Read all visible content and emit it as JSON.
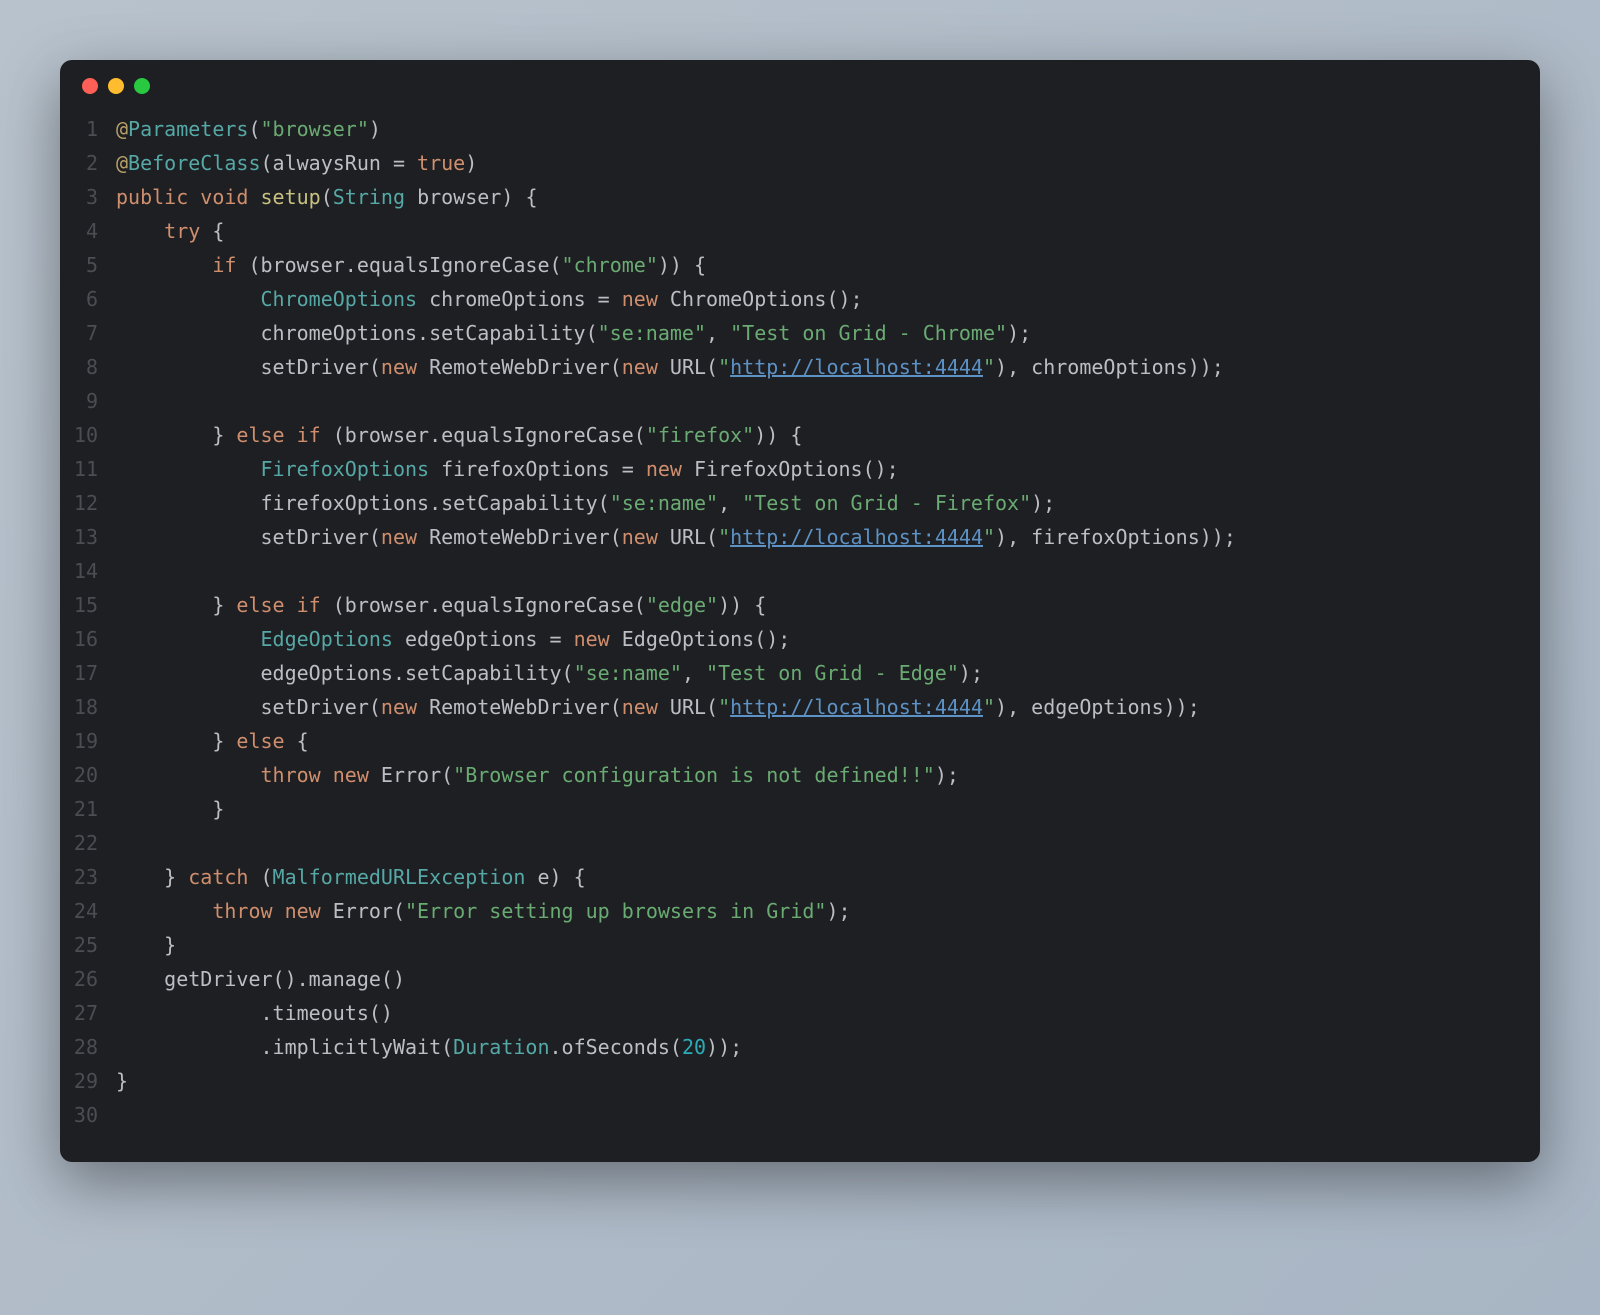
{
  "window": {
    "dots": {
      "close": "#ff5f57",
      "minimize": "#febc2e",
      "maximize": "#28c840"
    }
  },
  "code": {
    "lines": [
      {
        "num": "1",
        "tokens": [
          {
            "t": "@",
            "c": "tok-annotation"
          },
          {
            "t": "Parameters",
            "c": "tok-annotation-name"
          },
          {
            "t": "(",
            "c": "tok-plain"
          },
          {
            "t": "\"browser\"",
            "c": "tok-string"
          },
          {
            "t": ")",
            "c": "tok-plain"
          }
        ]
      },
      {
        "num": "2",
        "tokens": [
          {
            "t": "@",
            "c": "tok-annotation"
          },
          {
            "t": "BeforeClass",
            "c": "tok-annotation-name"
          },
          {
            "t": "(alwaysRun = ",
            "c": "tok-plain"
          },
          {
            "t": "true",
            "c": "tok-literal"
          },
          {
            "t": ")",
            "c": "tok-plain"
          }
        ]
      },
      {
        "num": "3",
        "tokens": [
          {
            "t": "public void ",
            "c": "tok-keyword"
          },
          {
            "t": "setup",
            "c": "tok-method"
          },
          {
            "t": "(",
            "c": "tok-plain"
          },
          {
            "t": "String ",
            "c": "tok-type"
          },
          {
            "t": "browser",
            "c": "tok-ident"
          },
          {
            "t": ") {",
            "c": "tok-plain"
          }
        ]
      },
      {
        "num": "4",
        "tokens": [
          {
            "t": "    ",
            "c": "tok-plain"
          },
          {
            "t": "try ",
            "c": "tok-keyword"
          },
          {
            "t": "{",
            "c": "tok-plain"
          }
        ]
      },
      {
        "num": "5",
        "tokens": [
          {
            "t": "        ",
            "c": "tok-plain"
          },
          {
            "t": "if ",
            "c": "tok-keyword"
          },
          {
            "t": "(browser.equalsIgnoreCase(",
            "c": "tok-plain"
          },
          {
            "t": "\"chrome\"",
            "c": "tok-string"
          },
          {
            "t": ")) {",
            "c": "tok-plain"
          }
        ]
      },
      {
        "num": "6",
        "tokens": [
          {
            "t": "            ",
            "c": "tok-plain"
          },
          {
            "t": "ChromeOptions ",
            "c": "tok-type"
          },
          {
            "t": "chromeOptions = ",
            "c": "tok-ident"
          },
          {
            "t": "new ",
            "c": "tok-keyword"
          },
          {
            "t": "ChromeOptions();",
            "c": "tok-plain"
          }
        ]
      },
      {
        "num": "7",
        "tokens": [
          {
            "t": "            chromeOptions.setCapability(",
            "c": "tok-plain"
          },
          {
            "t": "\"se:name\"",
            "c": "tok-string"
          },
          {
            "t": ", ",
            "c": "tok-plain"
          },
          {
            "t": "\"Test on Grid - Chrome\"",
            "c": "tok-string"
          },
          {
            "t": ");",
            "c": "tok-plain"
          }
        ]
      },
      {
        "num": "8",
        "tokens": [
          {
            "t": "            setDriver(",
            "c": "tok-plain"
          },
          {
            "t": "new ",
            "c": "tok-keyword"
          },
          {
            "t": "RemoteWebDriver(",
            "c": "tok-plain"
          },
          {
            "t": "new ",
            "c": "tok-keyword"
          },
          {
            "t": "URL(",
            "c": "tok-plain"
          },
          {
            "t": "\"",
            "c": "tok-string"
          },
          {
            "t": "http://localhost:4444",
            "c": "tok-string-url"
          },
          {
            "t": "\"",
            "c": "tok-string"
          },
          {
            "t": "), chromeOptions));",
            "c": "tok-plain"
          }
        ]
      },
      {
        "num": "9",
        "tokens": []
      },
      {
        "num": "10",
        "tokens": [
          {
            "t": "        } ",
            "c": "tok-plain"
          },
          {
            "t": "else if ",
            "c": "tok-keyword"
          },
          {
            "t": "(browser.equalsIgnoreCase(",
            "c": "tok-plain"
          },
          {
            "t": "\"firefox\"",
            "c": "tok-string"
          },
          {
            "t": ")) {",
            "c": "tok-plain"
          }
        ]
      },
      {
        "num": "11",
        "tokens": [
          {
            "t": "            ",
            "c": "tok-plain"
          },
          {
            "t": "FirefoxOptions ",
            "c": "tok-type"
          },
          {
            "t": "firefoxOptions = ",
            "c": "tok-ident"
          },
          {
            "t": "new ",
            "c": "tok-keyword"
          },
          {
            "t": "FirefoxOptions();",
            "c": "tok-plain"
          }
        ]
      },
      {
        "num": "12",
        "tokens": [
          {
            "t": "            firefoxOptions.setCapability(",
            "c": "tok-plain"
          },
          {
            "t": "\"se:name\"",
            "c": "tok-string"
          },
          {
            "t": ", ",
            "c": "tok-plain"
          },
          {
            "t": "\"Test on Grid - Firefox\"",
            "c": "tok-string"
          },
          {
            "t": ");",
            "c": "tok-plain"
          }
        ]
      },
      {
        "num": "13",
        "tokens": [
          {
            "t": "            setDriver(",
            "c": "tok-plain"
          },
          {
            "t": "new ",
            "c": "tok-keyword"
          },
          {
            "t": "RemoteWebDriver(",
            "c": "tok-plain"
          },
          {
            "t": "new ",
            "c": "tok-keyword"
          },
          {
            "t": "URL(",
            "c": "tok-plain"
          },
          {
            "t": "\"",
            "c": "tok-string"
          },
          {
            "t": "http://localhost:4444",
            "c": "tok-string-url"
          },
          {
            "t": "\"",
            "c": "tok-string"
          },
          {
            "t": "), firefoxOptions));",
            "c": "tok-plain"
          }
        ]
      },
      {
        "num": "14",
        "tokens": []
      },
      {
        "num": "15",
        "tokens": [
          {
            "t": "        } ",
            "c": "tok-plain"
          },
          {
            "t": "else if ",
            "c": "tok-keyword"
          },
          {
            "t": "(browser.equalsIgnoreCase(",
            "c": "tok-plain"
          },
          {
            "t": "\"edge\"",
            "c": "tok-string"
          },
          {
            "t": ")) {",
            "c": "tok-plain"
          }
        ]
      },
      {
        "num": "16",
        "tokens": [
          {
            "t": "            ",
            "c": "tok-plain"
          },
          {
            "t": "EdgeOptions ",
            "c": "tok-type"
          },
          {
            "t": "edgeOptions = ",
            "c": "tok-ident"
          },
          {
            "t": "new ",
            "c": "tok-keyword"
          },
          {
            "t": "EdgeOptions();",
            "c": "tok-plain"
          }
        ]
      },
      {
        "num": "17",
        "tokens": [
          {
            "t": "            edgeOptions.setCapability(",
            "c": "tok-plain"
          },
          {
            "t": "\"se:name\"",
            "c": "tok-string"
          },
          {
            "t": ", ",
            "c": "tok-plain"
          },
          {
            "t": "\"Test on Grid - Edge\"",
            "c": "tok-string"
          },
          {
            "t": ");",
            "c": "tok-plain"
          }
        ]
      },
      {
        "num": "18",
        "tokens": [
          {
            "t": "            setDriver(",
            "c": "tok-plain"
          },
          {
            "t": "new ",
            "c": "tok-keyword"
          },
          {
            "t": "RemoteWebDriver(",
            "c": "tok-plain"
          },
          {
            "t": "new ",
            "c": "tok-keyword"
          },
          {
            "t": "URL(",
            "c": "tok-plain"
          },
          {
            "t": "\"",
            "c": "tok-string"
          },
          {
            "t": "http://localhost:4444",
            "c": "tok-string-url"
          },
          {
            "t": "\"",
            "c": "tok-string"
          },
          {
            "t": "), edgeOptions));",
            "c": "tok-plain"
          }
        ]
      },
      {
        "num": "19",
        "tokens": [
          {
            "t": "        } ",
            "c": "tok-plain"
          },
          {
            "t": "else ",
            "c": "tok-keyword"
          },
          {
            "t": "{",
            "c": "tok-plain"
          }
        ]
      },
      {
        "num": "20",
        "tokens": [
          {
            "t": "            ",
            "c": "tok-plain"
          },
          {
            "t": "throw new ",
            "c": "tok-keyword"
          },
          {
            "t": "Error(",
            "c": "tok-plain"
          },
          {
            "t": "\"Browser configuration is not defined!!\"",
            "c": "tok-string"
          },
          {
            "t": ");",
            "c": "tok-plain"
          }
        ]
      },
      {
        "num": "21",
        "tokens": [
          {
            "t": "        }",
            "c": "tok-plain"
          }
        ]
      },
      {
        "num": "22",
        "tokens": []
      },
      {
        "num": "23",
        "tokens": [
          {
            "t": "    } ",
            "c": "tok-plain"
          },
          {
            "t": "catch ",
            "c": "tok-keyword"
          },
          {
            "t": "(",
            "c": "tok-plain"
          },
          {
            "t": "MalformedURLException ",
            "c": "tok-type"
          },
          {
            "t": "e) {",
            "c": "tok-plain"
          }
        ]
      },
      {
        "num": "24",
        "tokens": [
          {
            "t": "        ",
            "c": "tok-plain"
          },
          {
            "t": "throw new ",
            "c": "tok-keyword"
          },
          {
            "t": "Error(",
            "c": "tok-plain"
          },
          {
            "t": "\"Error setting up browsers in Grid\"",
            "c": "tok-string"
          },
          {
            "t": ");",
            "c": "tok-plain"
          }
        ]
      },
      {
        "num": "25",
        "tokens": [
          {
            "t": "    }",
            "c": "tok-plain"
          }
        ]
      },
      {
        "num": "26",
        "tokens": [
          {
            "t": "    getDriver().manage()",
            "c": "tok-plain"
          }
        ]
      },
      {
        "num": "27",
        "tokens": [
          {
            "t": "            .timeouts()",
            "c": "tok-plain"
          }
        ]
      },
      {
        "num": "28",
        "tokens": [
          {
            "t": "            .implicitlyWait(",
            "c": "tok-plain"
          },
          {
            "t": "Duration",
            "c": "tok-type"
          },
          {
            "t": ".",
            "c": "tok-plain"
          },
          {
            "t": "ofSeconds",
            "c": "tok-plain"
          },
          {
            "t": "(",
            "c": "tok-plain"
          },
          {
            "t": "20",
            "c": "tok-number"
          },
          {
            "t": "));",
            "c": "tok-plain"
          }
        ]
      },
      {
        "num": "29",
        "tokens": [
          {
            "t": "}",
            "c": "tok-plain"
          }
        ]
      },
      {
        "num": "30",
        "tokens": []
      }
    ]
  }
}
